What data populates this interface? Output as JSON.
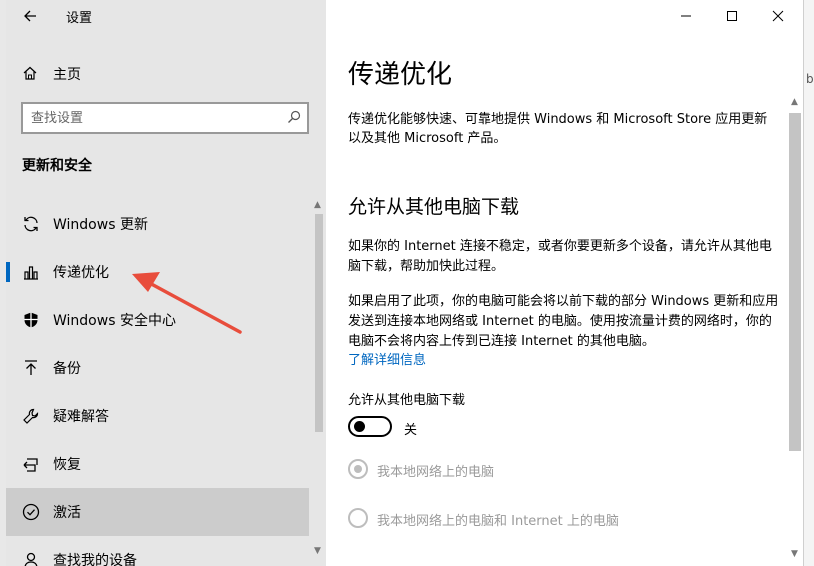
{
  "window": {
    "title": "设置",
    "controls": {
      "minimize": "minimize-icon",
      "maximize": "maximize-icon",
      "close": "close-icon"
    }
  },
  "background": {
    "partial_text": "b"
  },
  "sidebar": {
    "home_label": "主页",
    "search_placeholder": "查找设置",
    "section_heading": "更新和安全",
    "items": [
      {
        "label": "Windows 更新",
        "icon": "sync-icon",
        "active": false
      },
      {
        "label": "传递优化",
        "icon": "delivery-optimization-icon",
        "active": true
      },
      {
        "label": "Windows 安全中心",
        "icon": "shield-icon",
        "active": false
      },
      {
        "label": "备份",
        "icon": "backup-arrow-icon",
        "active": false
      },
      {
        "label": "疑难解答",
        "icon": "wrench-icon",
        "active": false
      },
      {
        "label": "恢复",
        "icon": "recovery-icon",
        "active": false
      },
      {
        "label": "激活",
        "icon": "checkmark-circle-icon",
        "active": false,
        "highlighted": true
      },
      {
        "label": "查找我的设备",
        "icon": "person-location-icon",
        "active": false
      }
    ]
  },
  "main": {
    "title": "传递优化",
    "description": "传递优化能够快速、可靠地提供 Windows 和 Microsoft Store 应用更新以及其他 Microsoft 产品。",
    "section_title": "允许从其他电脑下载",
    "paragraph1": "如果你的 Internet 连接不稳定，或者你要更新多个设备，请允许从其他电脑下载，帮助加快此过程。",
    "paragraph2": "如果启用了此项，你的电脑可能会将以前下载的部分 Windows 更新和应用发送到连接本地网络或 Internet 的电脑。使用按流量计费的网络时，你的电脑不会将内容上传到已连接 Internet 的其他电脑。",
    "learn_more": "了解详细信息",
    "toggle_label": "允许从其他电脑下载",
    "toggle_state": "关",
    "toggle_on": false,
    "radio_options": [
      {
        "label": "我本地网络上的电脑",
        "selected": true,
        "disabled": true
      },
      {
        "label": "我本地网络上的电脑和 Internet 上的电脑",
        "selected": false,
        "disabled": true
      }
    ]
  },
  "colors": {
    "accent": "#0067c0",
    "annotation": "#e84d3c",
    "sidebar_bg": "#e6e6e6"
  }
}
